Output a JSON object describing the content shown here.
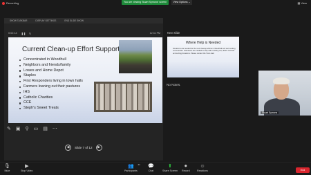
{
  "topbar": {
    "recording": "Recording",
    "share_banner": "You are viewing Stuart Symons' screen",
    "view_options": "View Options",
    "view": "View"
  },
  "ppt": {
    "toolbar": [
      "SHOW TASKBAR",
      "DISPLAY SETTINGS",
      "END SLIDE SHOW"
    ],
    "elapsed": "0:02:14",
    "clock": "12:31 PM",
    "slide_counter": "Slide 7 of 12"
  },
  "slide": {
    "title": "Current Clean-up Effort Support",
    "bullets": [
      "Concentrated in Woodhull",
      "Neighbors and friends/family",
      "Lowes and Home Depot",
      "Staples",
      "First Responders living in town halls",
      "Farmers loaning out their pastures",
      "IHS",
      "Catholic Charities",
      "CCE",
      "Steph's Sweet Treats"
    ]
  },
  "next_slide": {
    "label": "Next slide",
    "title": "Where Help is Needed",
    "body": "Donations are needed for the next cleanup efforts in Woodhull and surrounding communities. Volunteers are needed to help with mucking out, debris removal and sorting donations. Please contact the Town Hall."
  },
  "notes": "No Notes.",
  "video": {
    "name": "Stuart Symons"
  },
  "bottombar": {
    "mute": "Mute",
    "stop_video": "Stop Video",
    "participants": "Participants",
    "participants_count": "21",
    "chat": "Chat",
    "share_screen": "Share Screen",
    "record": "Record",
    "reactions": "Reactions",
    "end": "End"
  }
}
